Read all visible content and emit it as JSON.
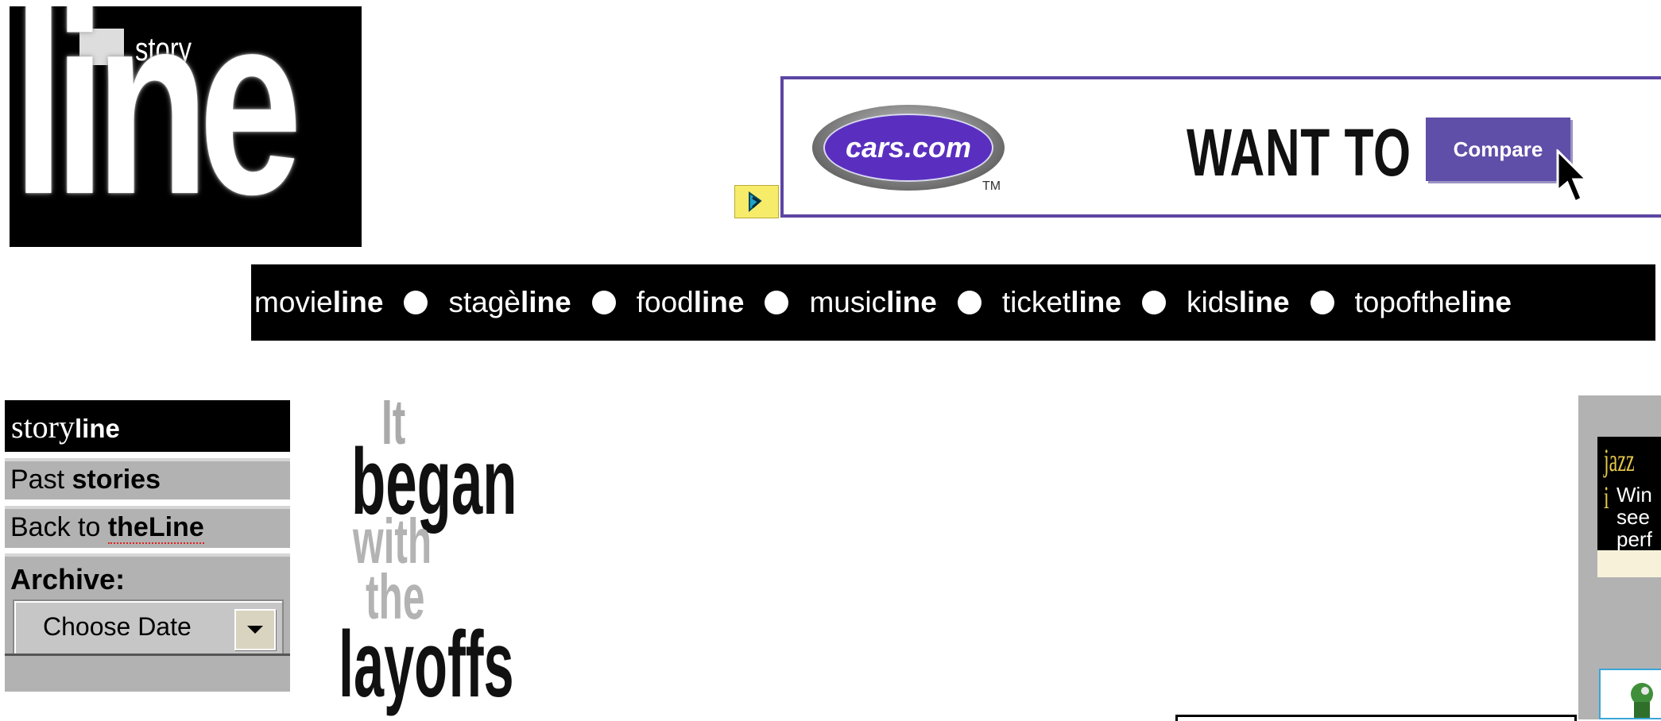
{
  "logo": {
    "small_word": "story",
    "big_word": "line"
  },
  "ad": {
    "brand": "cars.com",
    "trademark": "TM",
    "headline": "WANT TO",
    "button_label": "Compare"
  },
  "nav": {
    "items": [
      {
        "prefix": "movie",
        "suffix": "line"
      },
      {
        "prefix": "stagè",
        "suffix": "line"
      },
      {
        "prefix": "food",
        "suffix": "line"
      },
      {
        "prefix": "music",
        "suffix": "line"
      },
      {
        "prefix": "ticket",
        "suffix": "line"
      },
      {
        "prefix": "kids",
        "suffix": "line"
      },
      {
        "prefix": "topofthe",
        "suffix": "line"
      }
    ]
  },
  "sidebar": {
    "title_prefix": "story",
    "title_suffix": "line",
    "past_prefix": "Past ",
    "past_bold": "stories",
    "back_prefix": "Back to ",
    "back_bold": "theLine",
    "archive_label": "Archive:",
    "archive_select_value": "Choose Date"
  },
  "headline": {
    "line1": "It",
    "line2": "began",
    "line3": "with",
    "line4": "the",
    "line5": "layoffs"
  },
  "right_ad": {
    "title": "jazz i",
    "line1": "Win",
    "line2": "see",
    "line3": "perf"
  },
  "colors": {
    "nav_bg": "#000000",
    "sidebar_gray": "#b2b2b2",
    "ad_border": "#5c46a3",
    "ad_button": "#5f4fa8",
    "jazz_gold": "#e5c84a"
  }
}
